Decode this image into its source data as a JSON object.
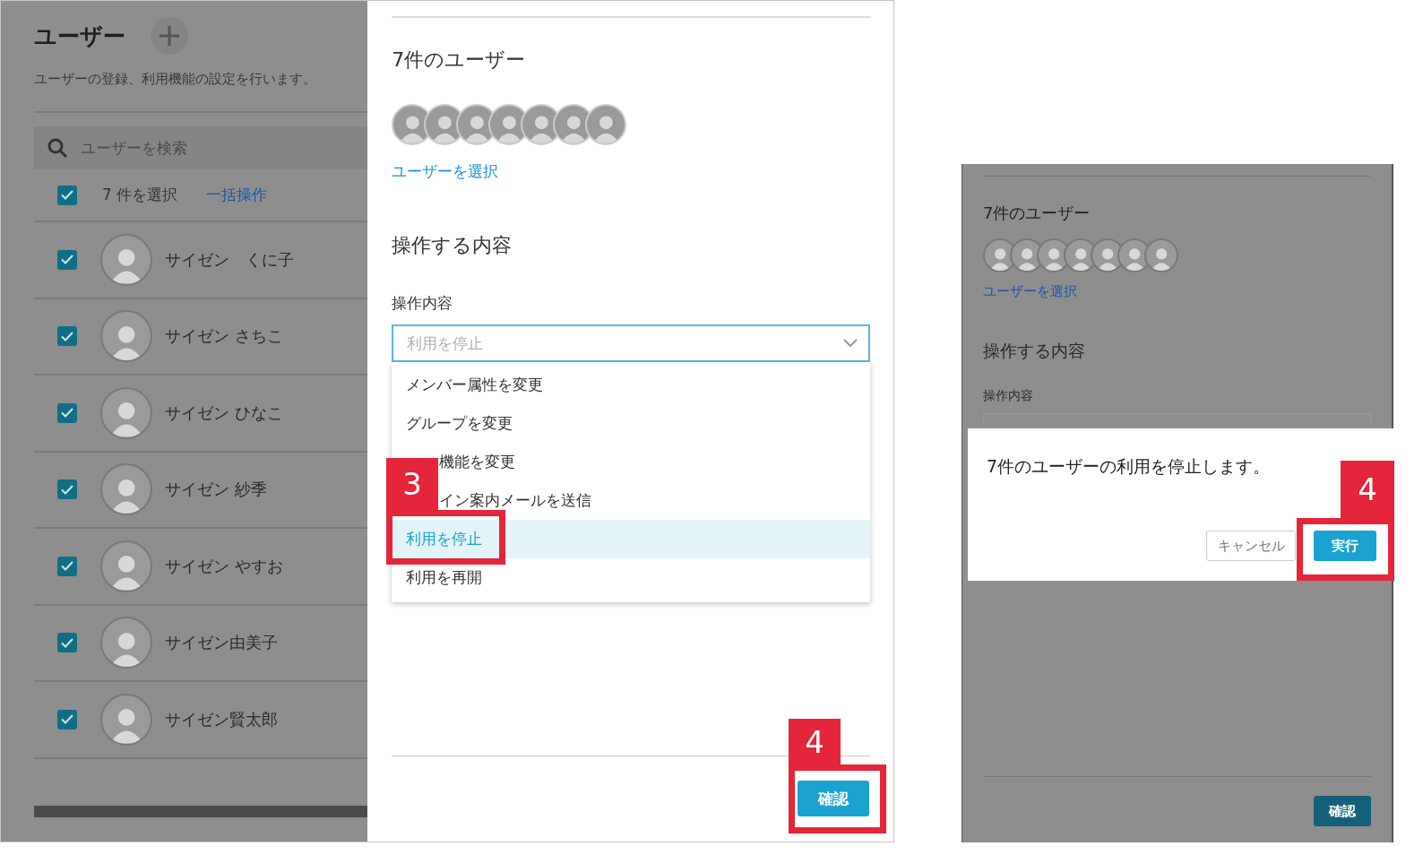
{
  "left_screen": {
    "page": {
      "title": "ユーザー",
      "description": "ユーザーの登録、利用機能の設定を行います。",
      "search": {
        "placeholder": "ユーザーを検索"
      },
      "selection": {
        "checked": true,
        "count_label": "7 件を選択",
        "bulk_link": "一括操作"
      },
      "users": [
        {
          "name": "サイゼン　くに子",
          "checked": true
        },
        {
          "name": "サイゼン さちこ",
          "checked": true
        },
        {
          "name": "サイゼン ひなこ",
          "checked": true
        },
        {
          "name": "サイゼン 紗季",
          "checked": true
        },
        {
          "name": "サイゼン やすお",
          "checked": true
        },
        {
          "name": "サイゼン由美子",
          "checked": true
        },
        {
          "name": "サイゼン賢太郎",
          "checked": true
        }
      ]
    },
    "drawer": {
      "users_heading": "7件のユーザー",
      "select_link": "ユーザーを選択",
      "section_heading": "操作する内容",
      "field_label": "操作内容",
      "select": {
        "placeholder": "利用を停止",
        "expanded": true
      },
      "options": [
        {
          "label": "メンバー属性を変更",
          "selected": false
        },
        {
          "label": "グループを変更",
          "selected": false
        },
        {
          "label": "機能を変更",
          "selected": false,
          "covered": true
        },
        {
          "label": "イン案内メールを送信",
          "selected": false,
          "covered": true
        },
        {
          "label": "利用を停止",
          "selected": true
        },
        {
          "label": "利用を再開",
          "selected": false
        }
      ],
      "confirm_button": "確認"
    },
    "callouts": [
      {
        "number": "3"
      },
      {
        "number": "4"
      }
    ]
  },
  "right_screen": {
    "users_heading": "7件のユーザー",
    "select_link": "ユーザーを選択",
    "section_heading": "操作する内容",
    "field_label": "操作内容",
    "dialog": {
      "message": "7件のユーザーの利用を停止します。",
      "cancel_button": "キャンセル",
      "execute_button": "実行"
    },
    "confirm_button": "確認",
    "callout": {
      "number": "4"
    }
  }
}
